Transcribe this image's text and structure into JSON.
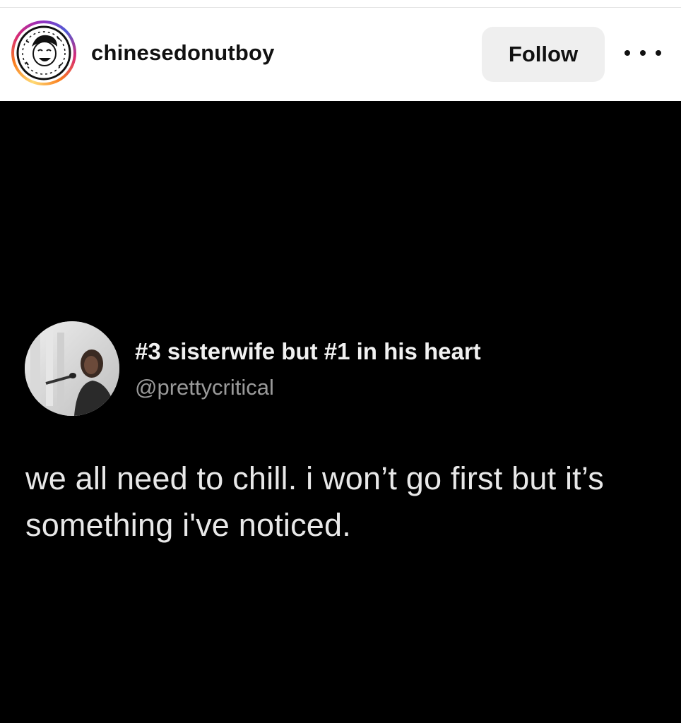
{
  "post_header": {
    "username": "chinesedonutboy",
    "follow_label": "Follow",
    "more_icon": "more-horizontal-icon",
    "avatar_icon": "donut-boy-logo"
  },
  "post_image": {
    "tweet": {
      "display_name": "#3 sisterwife but #1 in his heart",
      "handle": "@prettycritical",
      "text": "we all need to chill. i won’t go first but it’s something i've noticed."
    }
  },
  "colors": {
    "post_background": "#000000",
    "follow_button_bg": "#efefef",
    "story_ring": [
      "#feda75",
      "#fa7e1e",
      "#d62976",
      "#962fbf",
      "#4f5bd5"
    ]
  }
}
